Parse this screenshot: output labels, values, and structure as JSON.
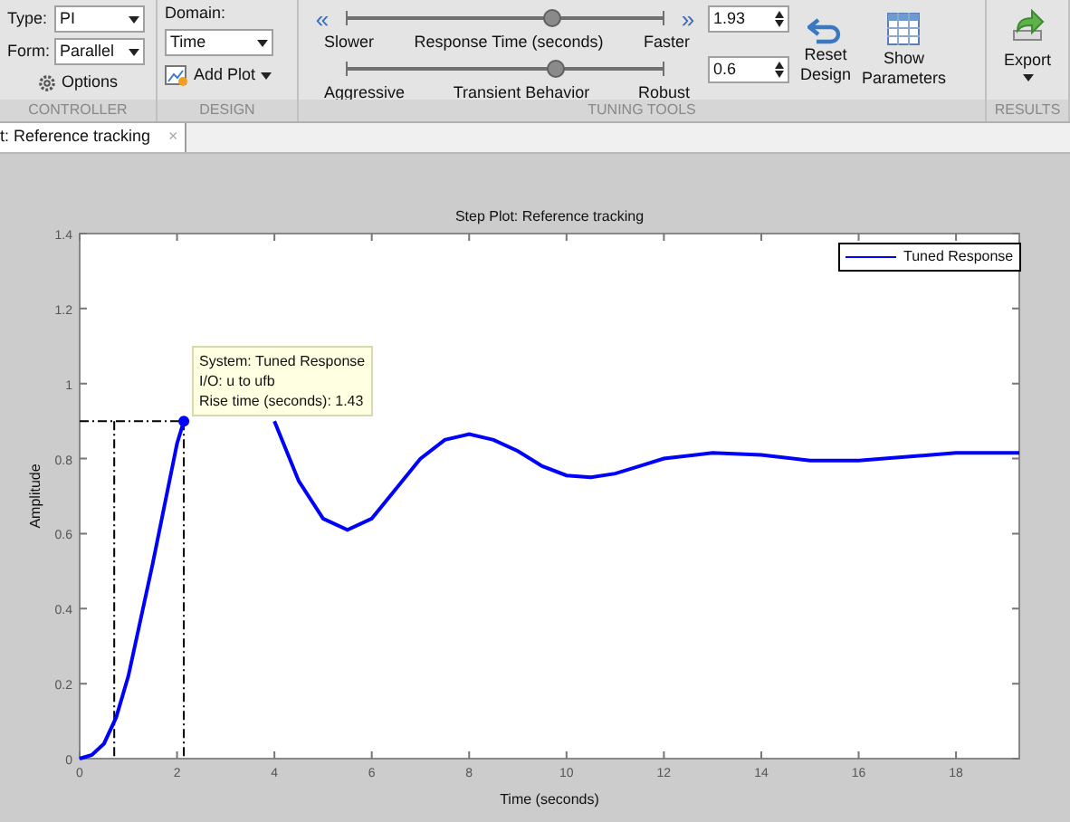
{
  "toolstrip": {
    "controller": {
      "type_label": "Type:",
      "type_value": "PI",
      "form_label": "Form:",
      "form_value": "Parallel",
      "options_button": "Options",
      "section_label": "CONTROLLER"
    },
    "design": {
      "domain_label": "Domain:",
      "domain_value": "Time",
      "add_plot_button": "Add Plot",
      "section_label": "DESIGN"
    },
    "tuning": {
      "sliders": [
        {
          "left_label": "Slower",
          "center_label": "Response Time (seconds)",
          "right_label": "Faster",
          "level": 0.65,
          "value": "1.93",
          "left_arrow": "«",
          "right_arrow": "»"
        },
        {
          "left_label": "Aggressive",
          "center_label": "Transient Behavior",
          "right_label": "Robust",
          "level": 0.66,
          "value": "0.6"
        }
      ],
      "reset_button": [
        "Reset",
        "Design"
      ],
      "show_parameters_button": [
        "Show",
        "Parameters"
      ],
      "section_label": "TUNING TOOLS"
    },
    "results": {
      "export_button": "Export",
      "section_label": "RESULTS"
    }
  },
  "tabs": [
    {
      "label": "t: Reference tracking",
      "close": "×",
      "selected": true
    }
  ],
  "plot": {
    "data_tip": [
      "System: Tuned Response",
      "I/O: u to ufb",
      "Rise time (seconds): 1.43"
    ],
    "chart_data": {
      "type": "line",
      "title": "Step Plot: Reference tracking",
      "xlabel": "Time (seconds)",
      "ylabel": "Amplitude",
      "xlim": [
        0,
        19.3
      ],
      "ylim": [
        0,
        1.4
      ],
      "xticks": [
        0,
        2,
        4,
        6,
        8,
        10,
        12,
        14,
        16,
        18
      ],
      "yticks": [
        0,
        0.2,
        0.4,
        0.6,
        0.8,
        1,
        1.2,
        1.4
      ],
      "x": [
        0,
        0.25,
        0.5,
        0.75,
        1,
        1.5,
        2,
        2.14,
        3,
        4,
        4.5,
        5,
        5.5,
        6,
        6.5,
        7,
        7.5,
        8,
        8.5,
        9,
        9.5,
        10,
        10.5,
        11,
        11.5,
        12,
        13,
        14,
        15,
        16,
        17,
        18,
        19.3
      ],
      "series": [
        {
          "name": "Tuned Response",
          "color": "#0000ff",
          "values": [
            0,
            0.01,
            0.04,
            0.11,
            0.22,
            0.52,
            0.84,
            0.9,
            null,
            0.9,
            0.74,
            0.64,
            0.61,
            0.64,
            0.72,
            0.8,
            0.85,
            0.865,
            0.85,
            0.82,
            0.78,
            0.755,
            0.75,
            0.76,
            0.78,
            0.8,
            0.815,
            0.81,
            0.795,
            0.795,
            0.805,
            0.815,
            0.815
          ]
        }
      ],
      "ref_lines": [
        {
          "axis": "x",
          "value": 0.71
        },
        {
          "axis": "x",
          "value": 2.14
        },
        {
          "axis": "y",
          "value": 0.9
        }
      ]
    }
  }
}
